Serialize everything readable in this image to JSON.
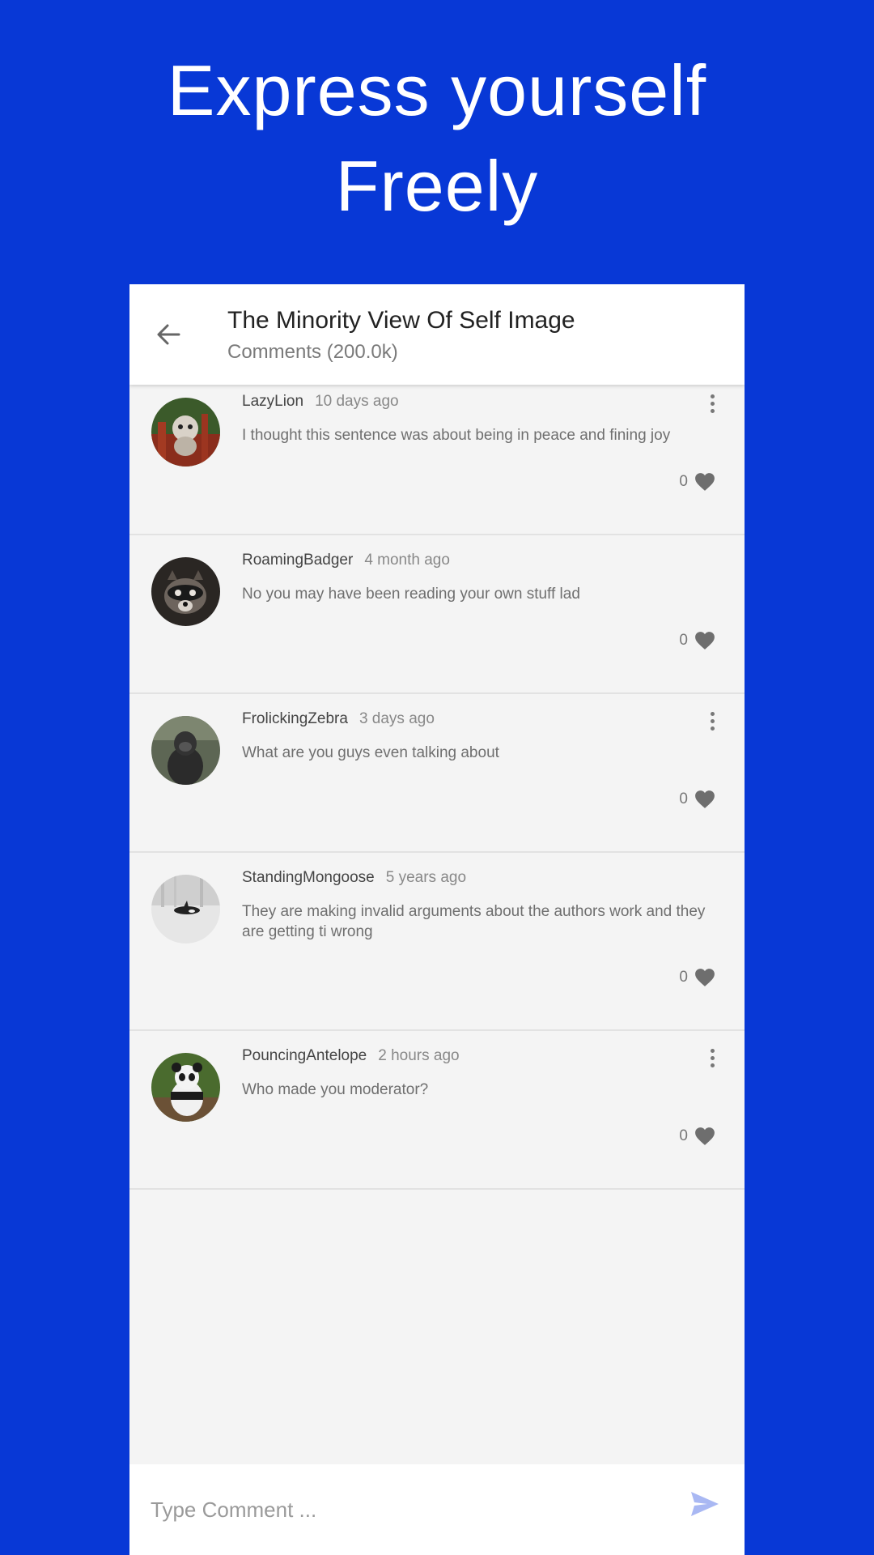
{
  "promo": {
    "line1": "Express yourself",
    "line2": "Freely"
  },
  "appbar": {
    "title": "The Minority View Of Self Image",
    "subtitle": "Comments (200.0k)"
  },
  "comments": [
    {
      "user": "LazyLion",
      "time": "10 days ago",
      "text": "I thought this sentence was about being in peace and fining joy",
      "likes": "0",
      "avatar": "red-panda-avatar"
    },
    {
      "user": "RoamingBadger",
      "time": "4 month ago",
      "text": "No you may have been reading your own stuff lad",
      "likes": "0",
      "avatar": "raccoon-avatar"
    },
    {
      "user": "FrolickingZebra",
      "time": "3 days ago",
      "text": "What are you guys even talking about",
      "likes": "0",
      "avatar": "gorilla-avatar"
    },
    {
      "user": "StandingMongoose",
      "time": "5 years ago",
      "text": "They are making invalid arguments about the authors work and they are getting ti wrong",
      "likes": "0",
      "avatar": "orca-avatar"
    },
    {
      "user": "PouncingAntelope",
      "time": "2 hours ago",
      "text": "Who made you moderator?",
      "likes": "0",
      "avatar": "panda-avatar"
    }
  ],
  "input": {
    "placeholder": "Type Comment ..."
  },
  "colors": {
    "background": "#0838d6",
    "send_icon": "#a9b8f3",
    "heart_icon": "#6e6e6e"
  }
}
